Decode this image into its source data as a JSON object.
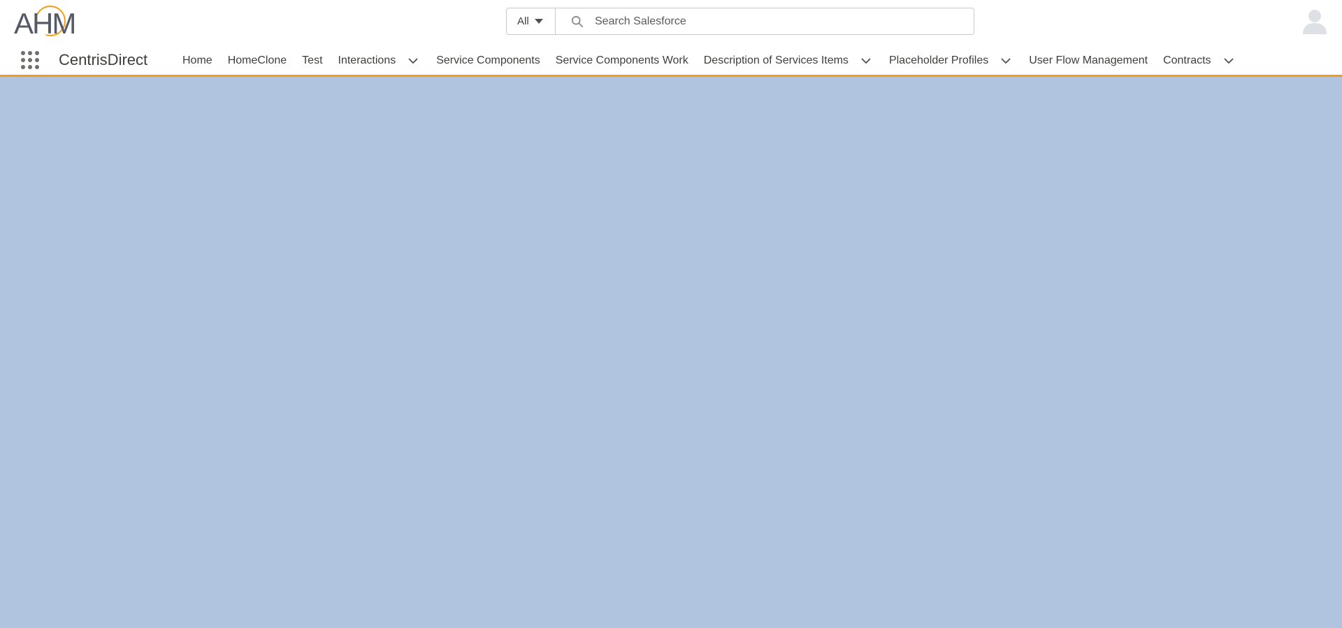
{
  "logo": {
    "text": "AHM"
  },
  "search": {
    "scope_label": "All",
    "placeholder": "Search Salesforce",
    "value": ""
  },
  "nav": {
    "app_name": "CentrisDirect",
    "items": [
      {
        "label": "Home",
        "has_dropdown": false
      },
      {
        "label": "HomeClone",
        "has_dropdown": false
      },
      {
        "label": "Test",
        "has_dropdown": false
      },
      {
        "label": "Interactions",
        "has_dropdown": true
      },
      {
        "label": "Service Components",
        "has_dropdown": false
      },
      {
        "label": "Service Components Work",
        "has_dropdown": false
      },
      {
        "label": "Description of Services Items",
        "has_dropdown": true
      },
      {
        "label": "Placeholder Profiles",
        "has_dropdown": true
      },
      {
        "label": "User Flow Management",
        "has_dropdown": false
      },
      {
        "label": "Contracts",
        "has_dropdown": true
      }
    ]
  },
  "colors": {
    "accent": "#f39c12",
    "page_background": "#b0c4df",
    "header_background": "#ffffff"
  },
  "icons": {
    "app_launcher": "waffle-grid-icon",
    "search": "search-icon",
    "avatar": "user-avatar-icon",
    "dropdown": "chevron-down-icon"
  }
}
